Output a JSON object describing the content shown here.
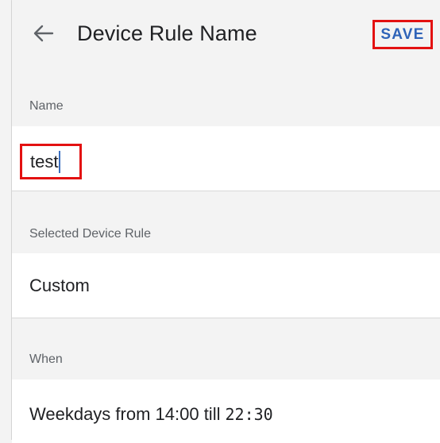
{
  "header": {
    "title": "Device Rule Name",
    "back_icon": "arrow-left-icon",
    "save_label": "SAVE"
  },
  "colors": {
    "accent": "#2e63b8",
    "highlight_border": "#e31111",
    "background": "#f3f3f3"
  },
  "name_section": {
    "label": "Name",
    "value": "test"
  },
  "rule_section": {
    "label": "Selected Device Rule",
    "value": "Custom"
  },
  "when_section": {
    "label": "When",
    "value": "Weekdays from 14:00 till",
    "time": "22:30"
  }
}
